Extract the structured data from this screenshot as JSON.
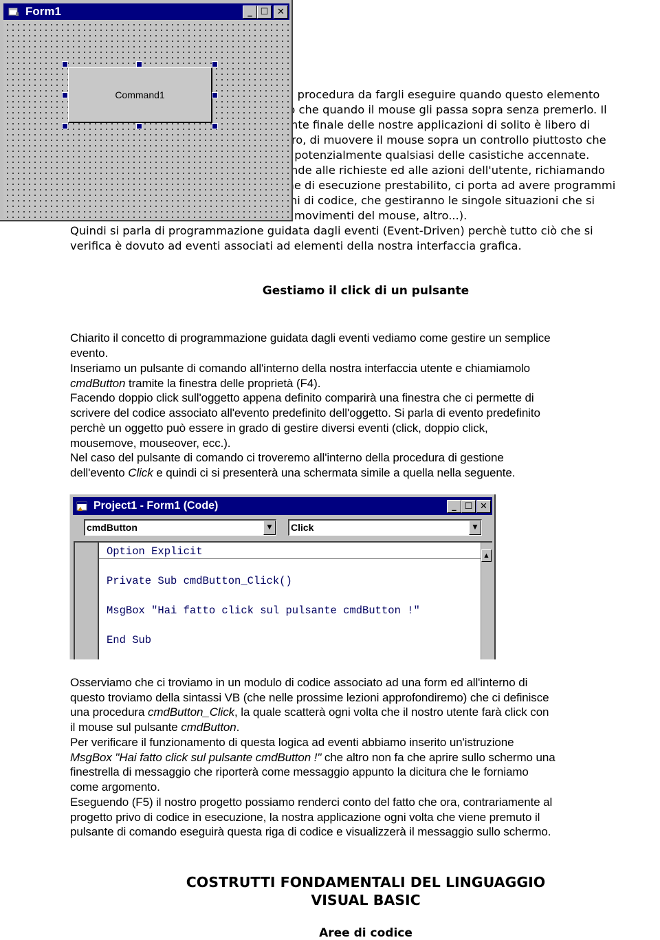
{
  "form1": {
    "title": "Form1",
    "command_button_label": "Command1",
    "controls": {
      "minimize": "_",
      "maximize": "☐",
      "close": "✕"
    }
  },
  "intro_lines": [
    "la procedura da fargli eseguire quando questo elemento",
    "to che quando il mouse gli passa sopra senza premerlo. Il",
    "ente finale delle nostre applicazioni di solito è libero di",
    "ltro, di muovere il mouse sopra un controllo piuttosto che",
    "e potenzialmente qualsiasi delle casistiche accennate.",
    "onde alle richieste ed alle azioni dell'utente, richiamando",
    "ine di esecuzione prestabilito, ci porta ad avere programmi",
    "chi di codice, che gestiranno le singole situazioni che si",
    "movimenti del mouse, altro...).",
    "Quindi si parla di programmazione guidata dagli eventi (Event-Driven) perchè tutto ciò che si",
    "verifica è dovuto ad eventi associati ad elementi della nostra interfaccia grafica."
  ],
  "section_heading": "Gestiamo il click di un pulsante",
  "section_body": {
    "l1": "Chiarito il concetto di programmazione guidata dagli eventi vediamo come gestire un semplice",
    "l2": "evento.",
    "l3": "Inseriamo un pulsante di comando all'interno della nostra interfaccia utente e chiamiamolo",
    "l4_italic": "cmdButton",
    "l4_rest": " tramite la finestra delle proprietà (F4).",
    "l5": "Facendo doppio click sull'oggetto appena definito comparirà una finestra che ci permette di",
    "l6": "scrivere del codice associato all'evento predefinito dell'oggetto. Si parla di evento predefinito",
    "l7": "perchè un oggetto può essere in grado di gestire diversi eventi (click, doppio click,",
    "l8": "mousemove, mouseover, ecc.).",
    "l9": "Nel caso del pulsante di comando ci troveremo all'interno della procedura di gestione",
    "l10_a": "dell'evento ",
    "l10_italic": "Click",
    "l10_b": " e quindi ci si presenterà una schermata simile a quella nella seguente."
  },
  "code_window": {
    "title": "Project1 - Form1 (Code)",
    "object_combo": "cmdButton",
    "procedure_combo": "Click",
    "code_lines": [
      "Option Explicit",
      "Private Sub cmdButton_Click()",
      "MsgBox \"Hai fatto click sul pulsante cmdButton !\"",
      "End Sub"
    ]
  },
  "explanation": {
    "l1": "Osserviamo che ci troviamo in un modulo di codice associato ad una form ed all'interno di",
    "l2": "questo troviamo della sintassi VB (che nelle prossime lezioni approfondiremo) che ci definisce",
    "l3_a": "una procedura ",
    "l3_italic": "cmdButton_Click",
    "l3_b": ", la quale scatterà ogni volta che il nostro utente farà click con",
    "l4_a": "il mouse sul pulsante ",
    "l4_italic": "cmdButton",
    "l4_b": ".",
    "l5": "Per verificare il funzionamento di questa logica ad eventi abbiamo inserito un'istruzione",
    "l6_italic": "MsgBox \"Hai fatto click sul pulsante cmdButton !\"",
    "l6_b": " che altro non fa che aprire sullo schermo una",
    "l7": "finestrella di messaggio che riporterà come messaggio appunto la dicitura che le forniamo",
    "l8": "come argomento.",
    "l9": "Eseguendo (F5) il nostro progetto possiamo renderci conto del fatto che ora, contrariamente al",
    "l10": "progetto privo di codice in esecuzione, la nostra applicazione ogni volta che viene premuto il",
    "l11": "pulsante di comando eseguirà questa riga di codice e visualizzerà il messaggio sullo schermo."
  },
  "chapter": {
    "title_line1": "COSTRUTTI FONDAMENTALI DEL LINGUAGGIO",
    "title_line2": "VISUAL BASIC",
    "subheading": "Aree di codice"
  }
}
